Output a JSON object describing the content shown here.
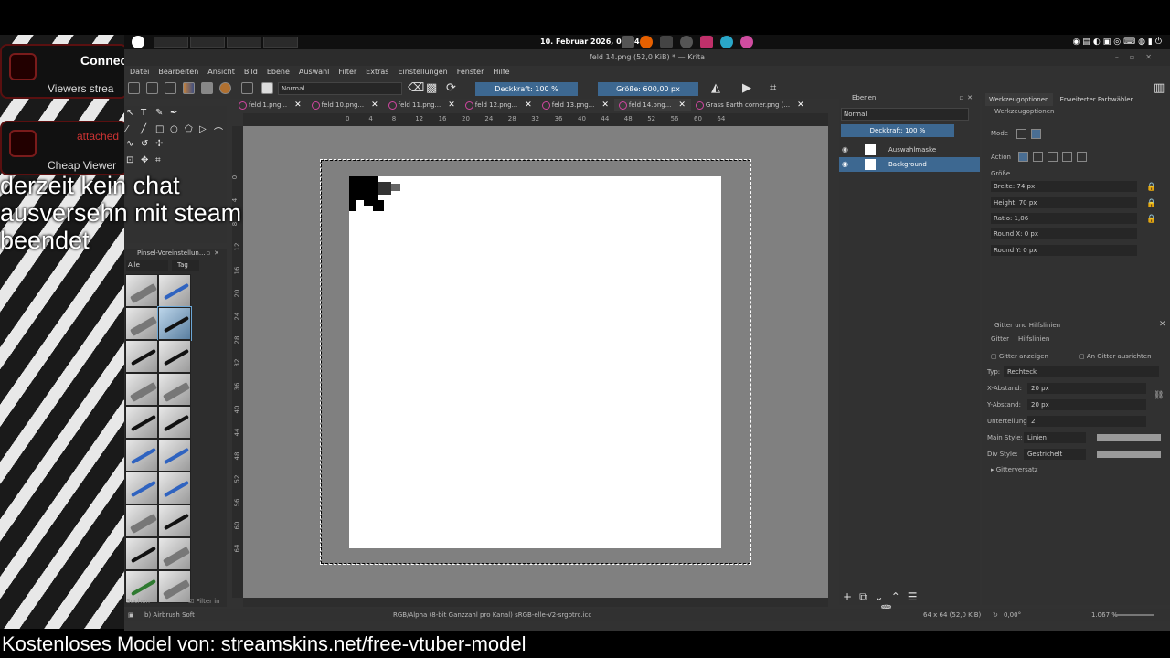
{
  "overlay": {
    "alert1_line1": "Connec",
    "alert1_line2": "Viewers strea",
    "alert2_line1": "attached",
    "alert2_line2": "Cheap Viewer",
    "chat_note_l1": "derzeit kein chat",
    "chat_note_l2": "ausversehn mit steam",
    "chat_note_l3": "beendet",
    "bottom_banner": "Kostenloses Model von: streamskins.net/free-vtuber-model"
  },
  "taskbar": {
    "clock": "10. Februar 2026, 05:04"
  },
  "window": {
    "title": "feld 14.png (52,0 KiB) * — Krita"
  },
  "menu": [
    "Datei",
    "Bearbeiten",
    "Ansicht",
    "Bild",
    "Ebene",
    "Auswahl",
    "Filter",
    "Extras",
    "Einstellungen",
    "Fenster",
    "Hilfe"
  ],
  "toolbar": {
    "blend_mode": "Normal",
    "opacity": "Deckkraft: 100 %",
    "size": "Größe: 600,00 px"
  },
  "tabs": [
    "feld 1.png...",
    "feld 10.png...",
    "feld 11.png...",
    "feld 12.png...",
    "feld 13.png...",
    "feld 14.png...",
    "Grass Earth corner.png (..."
  ],
  "ruler_h": [
    "0",
    "4",
    "8",
    "12",
    "16",
    "20",
    "24",
    "28",
    "32",
    "36",
    "40",
    "44",
    "48",
    "52",
    "56",
    "60",
    "64"
  ],
  "ruler_v": [
    "0",
    "4",
    "8",
    "12",
    "16",
    "20",
    "24",
    "28",
    "32",
    "36",
    "40",
    "44",
    "48",
    "52",
    "56",
    "60",
    "64"
  ],
  "presets": {
    "title": "Pinsel-Voreinstellun...",
    "filter": "Alle",
    "tag": "Tag",
    "search_placeholder": "Suchen",
    "filter_in_tag": "Filter in Tag"
  },
  "layers": {
    "title": "Ebenen",
    "blend": "Normal",
    "opacity": "Deckkraft: 100 %",
    "items": [
      "Auswahlmaske",
      "Background"
    ]
  },
  "tool_options": {
    "tab1": "Werkzeugoptionen",
    "tab2": "Erweiterter Farbwähler",
    "header": "Werkzeugoptionen",
    "mode": "Mode",
    "action": "Action",
    "size": "Größe",
    "width": "Breite: 74 px",
    "height": "Height: 70 px",
    "ratio": "Ratio: 1,06",
    "round_x": "Round X: 0 px",
    "round_y": "Round Y: 0 px"
  },
  "grid": {
    "title": "Gitter und Hilfslinien",
    "tab1": "Gitter",
    "tab2": "Hilfslinien",
    "show": "Gitter anzeigen",
    "snap": "An Gitter ausrichten",
    "type_label": "Typ:",
    "type": "Rechteck",
    "xspacing_label": "X-Abstand:",
    "xspacing": "20 px",
    "yspacing_label": "Y-Abstand:",
    "yspacing": "20 px",
    "subdiv_label": "Unterteilung:",
    "subdiv": "2",
    "main_style_label": "Main Style:",
    "main_style": "Linien",
    "div_style_label": "Div Style:",
    "div_style": "Gestrichelt",
    "offset": "Gitterversatz"
  },
  "status": {
    "brush": "b) Airbrush Soft",
    "color": "RGB/Alpha (8-bit Ganzzahl pro Kanal) sRGB-elle-V2-srgbtrc.icc",
    "dims": "64 x 64 (52,0 KiB)",
    "rotation": "0,00°",
    "zoom": "1.067 %"
  }
}
